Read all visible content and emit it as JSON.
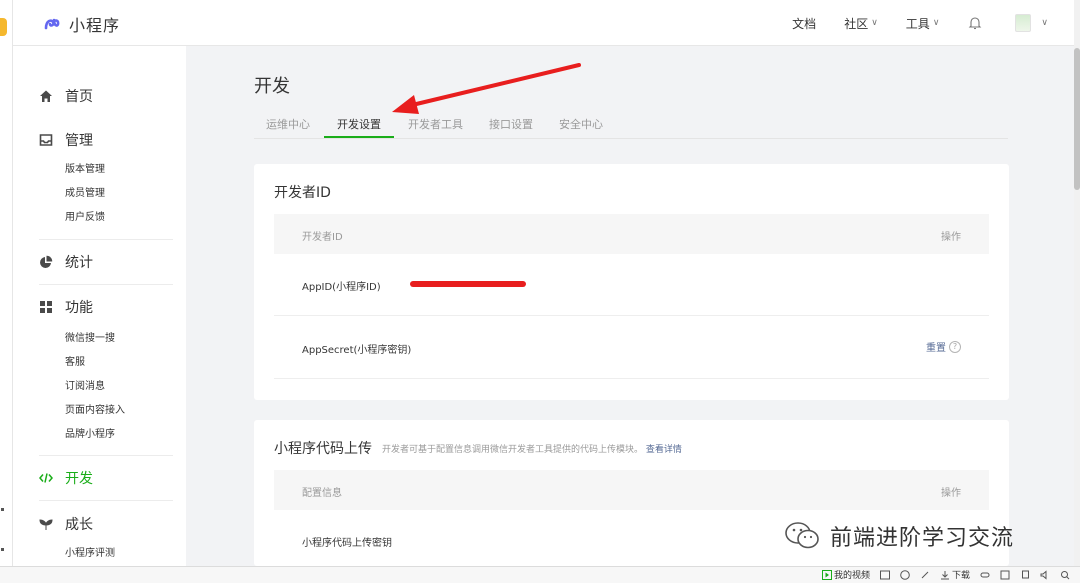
{
  "header": {
    "app_title": "小程序",
    "nav": {
      "docs": "文档",
      "community": "社区",
      "tools": "工具"
    }
  },
  "sidebar": {
    "home": "首页",
    "manage": {
      "label": "管理",
      "items": [
        "版本管理",
        "成员管理",
        "用户反馈"
      ]
    },
    "stats": "统计",
    "features": {
      "label": "功能",
      "items": [
        "微信搜一搜",
        "客服",
        "订阅消息",
        "页面内容接入",
        "品牌小程序"
      ]
    },
    "develop": "开发",
    "growth": {
      "label": "成长",
      "items": [
        "小程序评测"
      ]
    }
  },
  "main": {
    "title": "开发",
    "tabs": [
      "运维中心",
      "开发设置",
      "开发者工具",
      "接口设置",
      "安全中心"
    ],
    "active_tab": "开发设置",
    "dev_id_card": {
      "title": "开发者ID",
      "col1": "开发者ID",
      "col2": "操作",
      "rows": [
        {
          "label": "AppID(小程序ID)"
        },
        {
          "label": "AppSecret(小程序密钥)",
          "action": "重置"
        }
      ]
    },
    "upload_card": {
      "title": "小程序代码上传",
      "desc": "开发者可基于配置信息调用微信开发者工具提供的代码上传模块。",
      "link": "查看详情",
      "col1": "配置信息",
      "col2": "操作",
      "row_label": "小程序代码上传密钥"
    }
  },
  "watermark": "前端进阶学习交流",
  "statusbar": {
    "video": "我的视频",
    "download": "下载"
  },
  "colors": {
    "accent": "#1aad19",
    "link": "#576b95",
    "annotation": "#e81e1e"
  }
}
